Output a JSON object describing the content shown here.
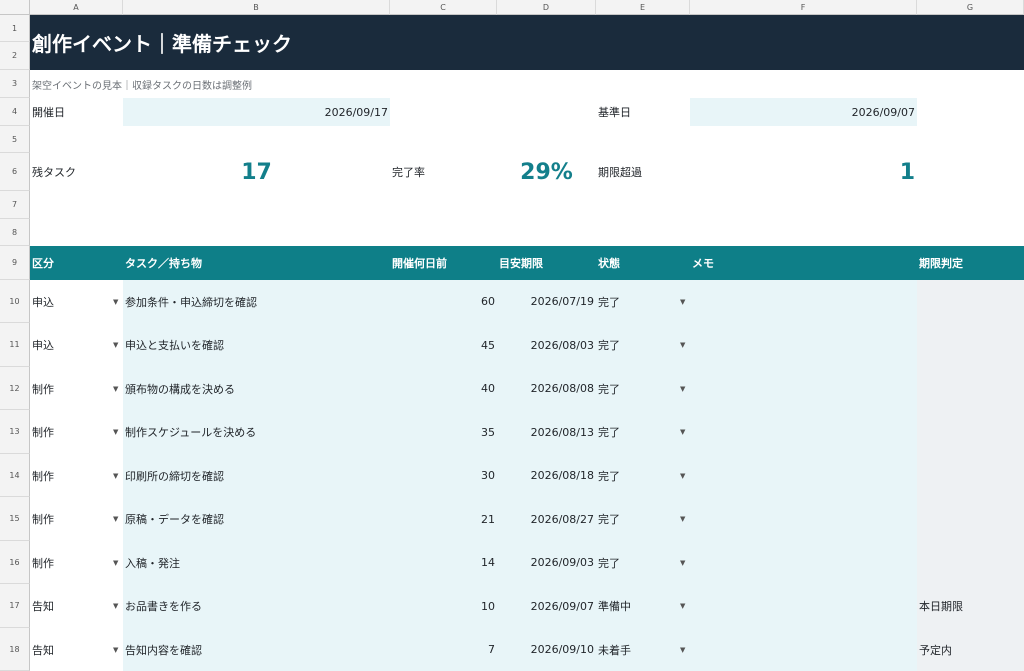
{
  "columns": [
    "A",
    "B",
    "C",
    "D",
    "E",
    "F",
    "G"
  ],
  "row_numbers": [
    "1",
    "2",
    "3",
    "4",
    "5",
    "6",
    "7",
    "8",
    "9",
    "10",
    "11",
    "12",
    "13",
    "14",
    "15",
    "16",
    "17",
    "18"
  ],
  "title": "創作イベント｜準備チェック",
  "subtitle": "架空イベントの見本｜収録タスクの日数は調整例",
  "event_date": {
    "label": "開催日",
    "value": "2026/09/17"
  },
  "base_date": {
    "label": "基準日",
    "value": "2026/09/07"
  },
  "stats": {
    "remaining": {
      "label": "残タスク",
      "value": "17"
    },
    "completion": {
      "label": "完了率",
      "value": "29%"
    },
    "overdue": {
      "label": "期限超過",
      "value": "1"
    }
  },
  "table": {
    "headers": {
      "category": "区分",
      "task": "タスク／持ち物",
      "days_before": "開催何日前",
      "target_date": "目安期限",
      "status": "状態",
      "memo": "メモ",
      "deadline_check": "期限判定"
    },
    "rows": [
      {
        "category": "申込",
        "task": "参加条件・申込締切を確認",
        "days_before": "60",
        "target_date": "2026/07/19",
        "status": "完了",
        "memo": "",
        "deadline_check": ""
      },
      {
        "category": "申込",
        "task": "申込と支払いを確認",
        "days_before": "45",
        "target_date": "2026/08/03",
        "status": "完了",
        "memo": "",
        "deadline_check": ""
      },
      {
        "category": "制作",
        "task": "頒布物の構成を決める",
        "days_before": "40",
        "target_date": "2026/08/08",
        "status": "完了",
        "memo": "",
        "deadline_check": ""
      },
      {
        "category": "制作",
        "task": "制作スケジュールを決める",
        "days_before": "35",
        "target_date": "2026/08/13",
        "status": "完了",
        "memo": "",
        "deadline_check": ""
      },
      {
        "category": "制作",
        "task": "印刷所の締切を確認",
        "days_before": "30",
        "target_date": "2026/08/18",
        "status": "完了",
        "memo": "",
        "deadline_check": ""
      },
      {
        "category": "制作",
        "task": "原稿・データを確認",
        "days_before": "21",
        "target_date": "2026/08/27",
        "status": "完了",
        "memo": "",
        "deadline_check": ""
      },
      {
        "category": "制作",
        "task": "入稿・発注",
        "days_before": "14",
        "target_date": "2026/09/03",
        "status": "完了",
        "memo": "",
        "deadline_check": ""
      },
      {
        "category": "告知",
        "task": "お品書きを作る",
        "days_before": "10",
        "target_date": "2026/09/07",
        "status": "準備中",
        "memo": "",
        "deadline_check": "本日期限"
      },
      {
        "category": "告知",
        "task": "告知内容を確認",
        "days_before": "7",
        "target_date": "2026/09/10",
        "status": "未着手",
        "memo": "",
        "deadline_check": "予定内"
      }
    ]
  },
  "colors": {
    "title_bg": "#1a2b3c",
    "header_bg": "#0e7f88",
    "accent_text": "#137f8b",
    "input_bg": "#e8f5f8",
    "judge_bg": "#eef1f3"
  },
  "icons": {
    "dropdown": "dropdown-arrow-icon"
  }
}
